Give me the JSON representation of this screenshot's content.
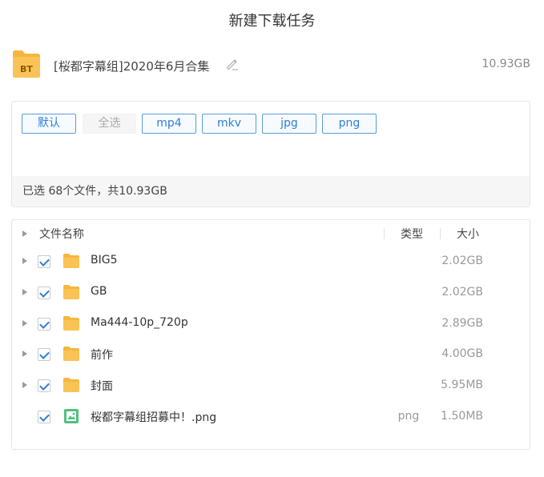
{
  "dialog": {
    "title": "新建下载任务"
  },
  "torrent": {
    "icon": "bt-torrent-icon",
    "icon_label": "BT",
    "name": "[桜都字幕组]2020年6月合集",
    "size": "10.93GB",
    "folder_color": "#f6b63d"
  },
  "filters": {
    "buttons": [
      {
        "label": "默认",
        "enabled": true
      },
      {
        "label": "全选",
        "enabled": false
      },
      {
        "label": "mp4",
        "enabled": true
      },
      {
        "label": "mkv",
        "enabled": true
      },
      {
        "label": "jpg",
        "enabled": true
      },
      {
        "label": "png",
        "enabled": true
      }
    ],
    "status": "已选 68个文件，共10.93GB",
    "accent_color": "#2f7ed8"
  },
  "file_list": {
    "columns": {
      "name": "文件名称",
      "type": "类型",
      "size": "大小"
    },
    "rows": [
      {
        "name": "BIG5",
        "type": "",
        "size": "2.02GB",
        "kind": "folder",
        "checked": true
      },
      {
        "name": "GB",
        "type": "",
        "size": "2.02GB",
        "kind": "folder",
        "checked": true
      },
      {
        "name": "Ma444-10p_720p",
        "type": "",
        "size": "2.89GB",
        "kind": "folder",
        "checked": true
      },
      {
        "name": "前作",
        "type": "",
        "size": "4.00GB",
        "kind": "folder",
        "checked": true
      },
      {
        "name": "封面",
        "type": "",
        "size": "5.95MB",
        "kind": "folder",
        "checked": true
      },
      {
        "name": "桜都字幕组招募中！.png",
        "type": "png",
        "size": "1.50MB",
        "kind": "image",
        "checked": true
      }
    ]
  }
}
